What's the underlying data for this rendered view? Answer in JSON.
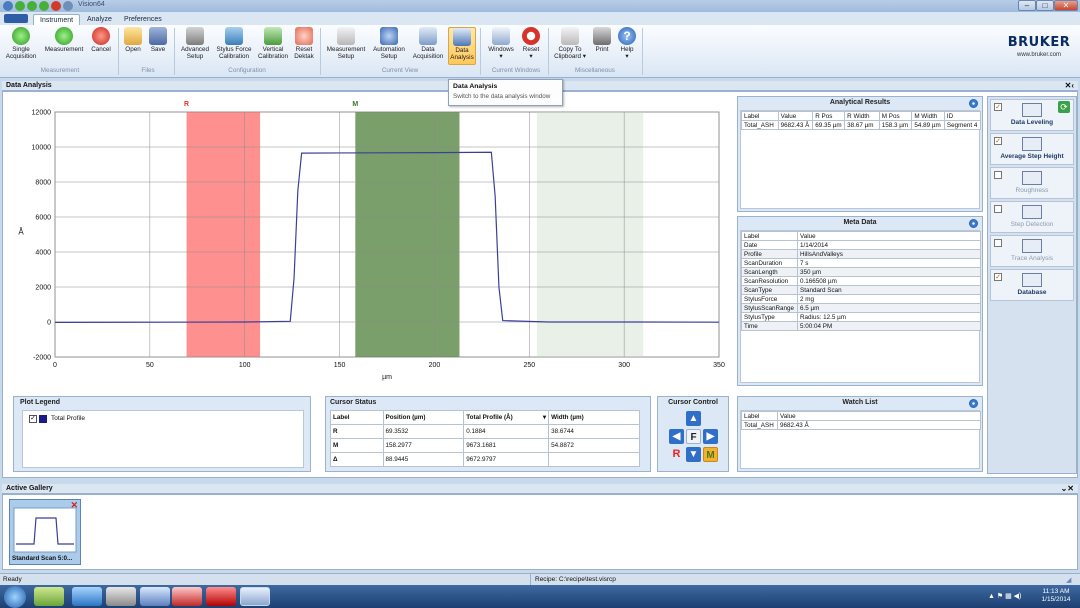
{
  "window": {
    "title": "Vision64"
  },
  "tabs": [
    {
      "label": "Instrument"
    },
    {
      "label": "Analyze"
    },
    {
      "label": "Preferences"
    }
  ],
  "ribbon": {
    "buttons": {
      "single_acquisition": "Single Acquisition",
      "measurement": "Measurement",
      "cancel": "Cancel",
      "open": "Open",
      "save": "Save",
      "advanced_setup": "Advanced Setup",
      "stylus_force_calibration": "Stylus Force Calibration",
      "vertical_calibration": "Vertical Calibration",
      "reset_dektak": "Reset Dektak",
      "measurement_setup": "Measurement Setup",
      "automation_setup": "Automation Setup",
      "data_acquisition": "Data Acquisition",
      "data_analysis": "Data Analysis",
      "windows": "Windows",
      "reset": "Reset",
      "copy_to_clipboard": "Copy To Clipboard",
      "print": "Print",
      "help": "Help"
    },
    "groups": {
      "measurement": "Measurement",
      "files": "Files",
      "configuration": "Configuration",
      "current_view": "Current View",
      "current_windows": "Current Windows",
      "miscellaneous": "Miscellaneous"
    },
    "brand": {
      "logo_text": "BRUKER",
      "url": "www.bruker.com"
    }
  },
  "tooltip": {
    "title": "Data Analysis",
    "text": "Switch to the data analysis window"
  },
  "data_analysis": {
    "title": "Data Analysis"
  },
  "chart_data": {
    "type": "line",
    "xlabel": "µm",
    "ylabel": "Å",
    "xlim": [
      0,
      350
    ],
    "ylim": [
      -2000,
      12000
    ],
    "xticks": [
      0,
      50,
      100,
      150,
      200,
      250,
      300,
      350
    ],
    "yticks": [
      -2000,
      0,
      2000,
      4000,
      6000,
      8000,
      10000,
      12000
    ],
    "grid": true,
    "series": [
      {
        "name": "Total Profile",
        "color": "#3b3f9a",
        "x": [
          0,
          60,
          100,
          124,
          126,
          128,
          130,
          150,
          200,
          230,
          232,
          234,
          236,
          260,
          300,
          350
        ],
        "y": [
          -20,
          -10,
          0,
          40,
          2500,
          7500,
          9650,
          9660,
          9680,
          9700,
          7200,
          2000,
          80,
          0,
          0,
          -10
        ]
      }
    ],
    "cursors": [
      {
        "label": "R",
        "from": 69.35,
        "to": 108.1,
        "color": "#ff6b6b",
        "label_color": "#e53030"
      },
      {
        "label": "M",
        "from": 158.3,
        "to": 213.2,
        "color": "#4e7f3a",
        "label_color": "#3c7a24"
      },
      {
        "label": "",
        "from": 254,
        "to": 310,
        "color": "#dbe6d8",
        "label_color": ""
      }
    ]
  },
  "analytical_results": {
    "title": "Analytical Results",
    "headers": [
      "Label",
      "Value",
      "R Pos",
      "R Width",
      "M Pos",
      "M Width",
      "ID"
    ],
    "rows": [
      [
        "Total_ASH",
        "9682.43 Å",
        "69.35 µm",
        "38.67 µm",
        "158.3 µm",
        "54.89 µm",
        "Segment 4"
      ]
    ]
  },
  "meta_data": {
    "title": "Meta Data",
    "headers": [
      "Label",
      "Value"
    ],
    "rows": [
      [
        "Date",
        "1/14/2014"
      ],
      [
        "Profile",
        "HillsAndValleys"
      ],
      [
        "ScanDuration",
        "7 s"
      ],
      [
        "ScanLength",
        "350 µm"
      ],
      [
        "ScanResolution",
        "0.166508 µm"
      ],
      [
        "ScanType",
        "Standard Scan"
      ],
      [
        "StylusForce",
        "2 mg"
      ],
      [
        "StylusScanRange",
        "6.5 µm"
      ],
      [
        "StylusType",
        "Radius: 12.5 µm"
      ],
      [
        "Time",
        "5:00:04 PM"
      ]
    ]
  },
  "watch_list": {
    "title": "Watch List",
    "headers": [
      "Label",
      "Value"
    ],
    "rows": [
      [
        "Total_ASH",
        "9682.43 Å"
      ]
    ]
  },
  "plot_legend": {
    "title": "Plot Legend",
    "entry": "Total Profile"
  },
  "cursor_status": {
    "title": "Cursor Status",
    "headers": [
      "Label",
      "Position (µm)",
      "Total Profile (Å)",
      "Width (µm)"
    ],
    "rows": [
      [
        "R",
        "69.3532",
        "0.1884",
        "38.6744"
      ],
      [
        "M",
        "158.2977",
        "9673.1681",
        "54.8872"
      ],
      [
        "Δ",
        "88.9445",
        "9672.9797",
        ""
      ]
    ]
  },
  "cursor_control": {
    "title": "Cursor Control",
    "r": "R",
    "f": "F",
    "m": "M"
  },
  "right_panel": [
    {
      "label": "Data Leveling",
      "checked": true,
      "enabled": true
    },
    {
      "label": "Average Step Height",
      "checked": true,
      "enabled": true
    },
    {
      "label": "Roughness",
      "checked": false,
      "enabled": false
    },
    {
      "label": "Step Detection",
      "checked": false,
      "enabled": false
    },
    {
      "label": "Trace Analysis",
      "checked": false,
      "enabled": false
    },
    {
      "label": "Database",
      "checked": true,
      "enabled": true
    }
  ],
  "gallery": {
    "title": "Active Gallery",
    "thumb_label": "Standard Scan 5:0..."
  },
  "statusbar": {
    "left": "Ready",
    "recipe": "Recipe: C:\\recipe\\test.visrcp"
  },
  "taskbar": {
    "time": "11:13 AM",
    "date": "1/15/2014"
  }
}
